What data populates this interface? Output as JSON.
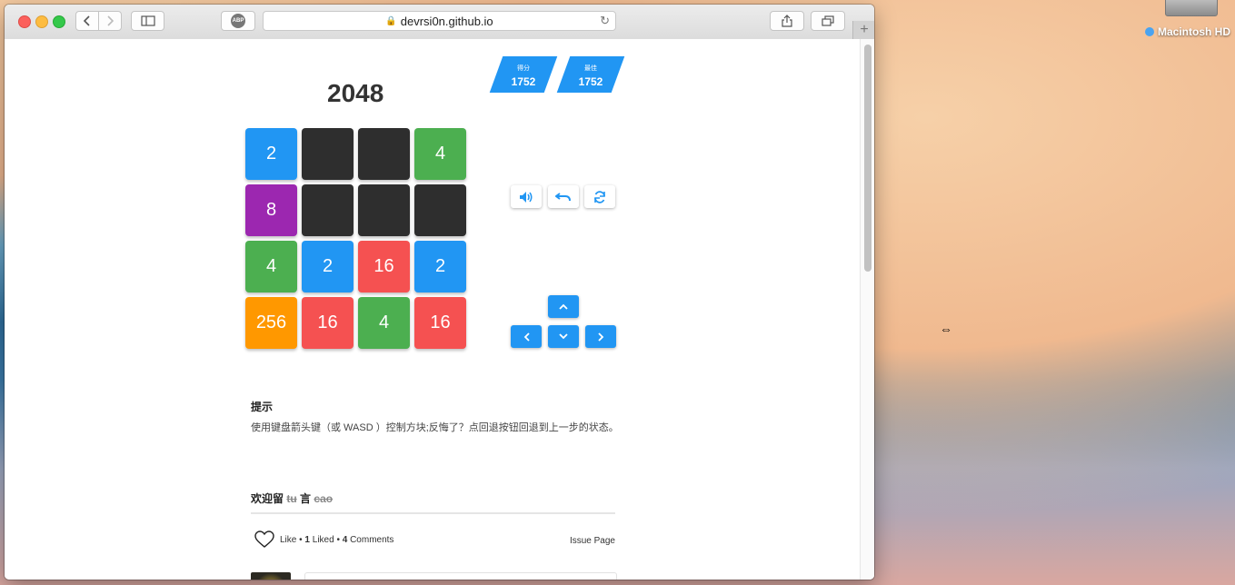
{
  "desktop": {
    "disk_label": "Macintosh HD"
  },
  "browser": {
    "url": "devrsi0n.github.io",
    "abp_label": "ABP"
  },
  "game": {
    "title": "2048",
    "score_label": "得分",
    "score_value": "1752",
    "best_label": "最佳",
    "best_value": "1752",
    "tiles": [
      [
        "2",
        "",
        "",
        "4"
      ],
      [
        "8",
        "",
        "",
        ""
      ],
      [
        "4",
        "2",
        "16",
        "2"
      ],
      [
        "256",
        "16",
        "4",
        "16"
      ]
    ],
    "tile_colors": {
      "empty": "#2e2e2e",
      "2": "#2196f3",
      "4": "#4caf50",
      "8": "#9c27b0",
      "16": "#f55151",
      "256": "#ff9800"
    }
  },
  "hint": {
    "title": "提示",
    "text": "使用键盘箭头键（或 WASD ）控制方块;反悔了？点回退按钮回退到上一步的状态。"
  },
  "comments": {
    "heading_main": "欢迎留",
    "heading_strike1": "tu",
    "heading_mid": "言",
    "heading_strike2": "cao",
    "like_label": "Like",
    "liked_count": "1",
    "liked_label": "Liked",
    "comment_count": "4",
    "comments_label": "Comments",
    "issue_page": "Issue Page"
  }
}
